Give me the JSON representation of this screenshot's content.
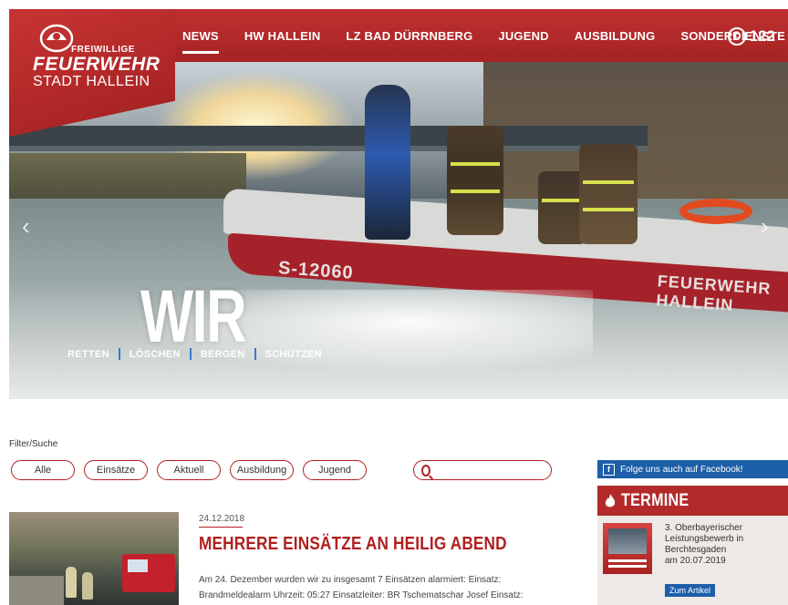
{
  "brand": {
    "line1": "FREIWILLIGE",
    "line2": "FEUERWEHR",
    "line3": "STADT HALLEIN"
  },
  "nav": {
    "items": [
      "NEWS",
      "HW HALLEIN",
      "LZ BAD DÜRRNBERG",
      "JUGEND",
      "AUSBILDUNG",
      "SONDERDIENSTE"
    ],
    "active": "NEWS"
  },
  "emergency": {
    "number": "122",
    "icon": "phone-icon"
  },
  "hero": {
    "title": "WIR",
    "subtitle_words": [
      "RETTEN",
      "LÖSCHEN",
      "BERGEN",
      "SCHÜTZEN"
    ],
    "boat_number": "S-12060",
    "boat_name": "FEUERWEHR HALLEIN"
  },
  "filter": {
    "label": "Filter/Suche",
    "buttons": [
      "Alle",
      "Einsätze",
      "Aktuell",
      "Ausbildung",
      "Jugend"
    ],
    "search_placeholder": ""
  },
  "article": {
    "date": "24.12.2018",
    "title": "MEHRERE EINSÄTZE AN HEILIG ABEND",
    "body_line1": "Am 24. Dezember wurden wir zu insgesamt 7 Einsätzen alarmiert: Einsatz:",
    "body_line2": "Brandmeldealarm Uhrzeit: 05:27 Einsatzleiter: BR Tschematschar Josef Einsatz:"
  },
  "sidebar": {
    "facebook_text": "Folge uns auch auf Facebook!",
    "termine_title": "TERMINE",
    "event": {
      "line1": "3. Oberbayerischer",
      "line2": "Leistungsbewerb in",
      "line3": "Berchtesgaden",
      "line4": "am 20.07.2019",
      "button": "Zum Artikel"
    }
  },
  "colors": {
    "brand_red": "#b22a2a",
    "facebook_blue": "#1d5ea8",
    "accent_blue": "#3a78c8"
  }
}
